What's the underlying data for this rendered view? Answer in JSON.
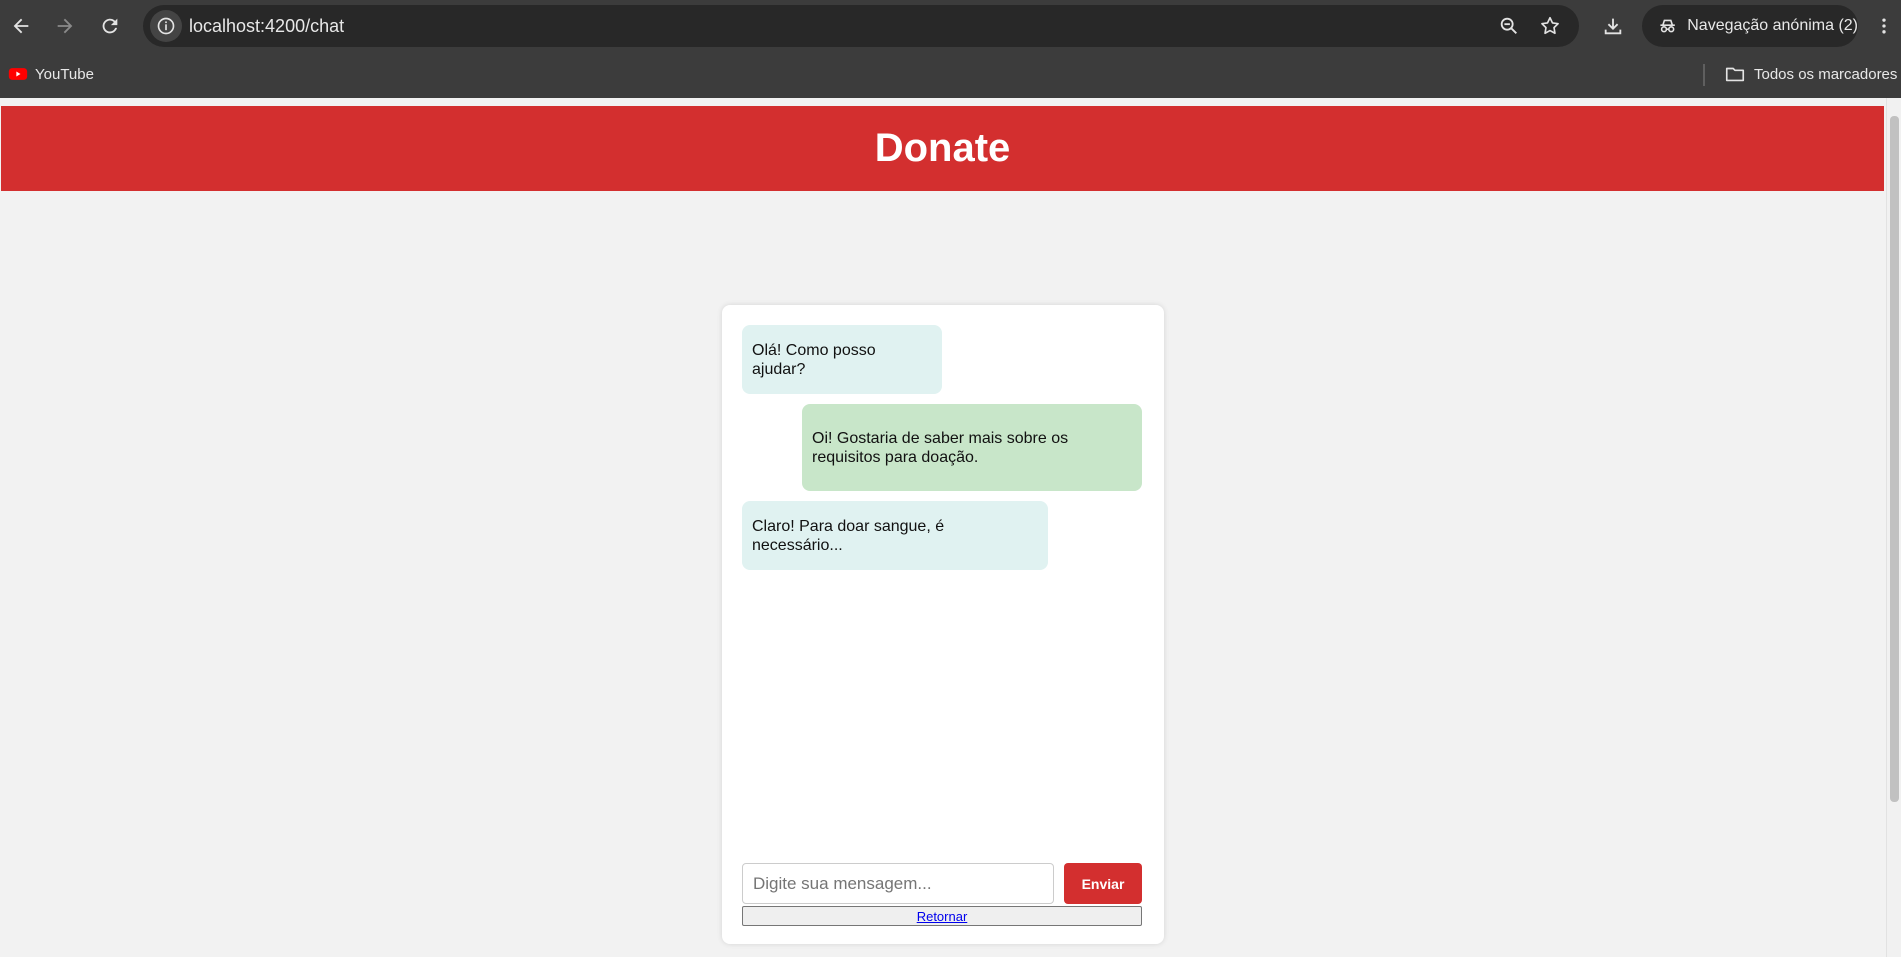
{
  "browser": {
    "url": "localhost:4200/chat",
    "incognito_label": "Navegação anónima (2)",
    "bookmarks": [
      {
        "label": "YouTube",
        "icon": "youtube-icon"
      }
    ],
    "all_bookmarks_label": "Todos os marcadores"
  },
  "header": {
    "title": "Donate"
  },
  "chat": {
    "messages": [
      {
        "sender": "bot",
        "text": "Olá! Como posso ajudar?"
      },
      {
        "sender": "user",
        "text": "Oi! Gostaria de saber mais sobre os requisitos para doação."
      },
      {
        "sender": "bot",
        "text": "Claro! Para doar sangue, é necessário..."
      }
    ],
    "input_placeholder": "Digite sua mensagem...",
    "input_value": "",
    "send_label": "Enviar",
    "back_label": "Retornar"
  },
  "colors": {
    "brand": "#d32f2f",
    "bot_bubble": "#e0f2f1",
    "user_bubble": "#c8e6c9"
  }
}
